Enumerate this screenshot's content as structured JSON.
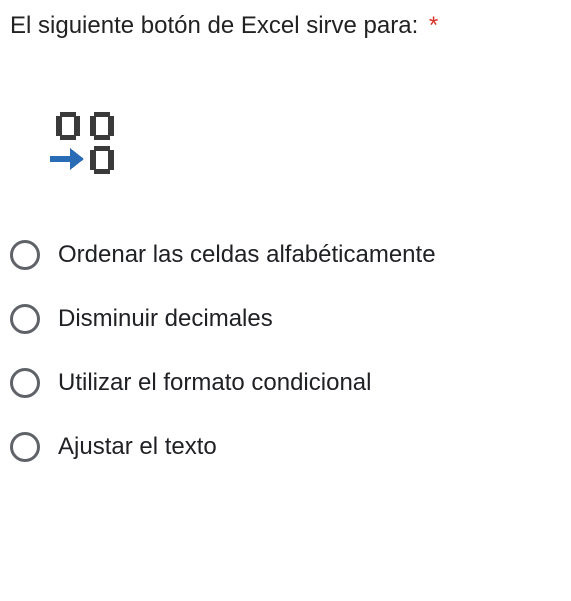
{
  "question": {
    "text": "El siguiente botón de Excel sirve para:",
    "required_marker": "*",
    "icon_name": "decrease-decimal-icon"
  },
  "options": [
    {
      "label": "Ordenar las celdas alfabéticamente"
    },
    {
      "label": "Disminuir decimales"
    },
    {
      "label": "Utilizar el formato condicional"
    },
    {
      "label": "Ajustar el texto"
    }
  ]
}
